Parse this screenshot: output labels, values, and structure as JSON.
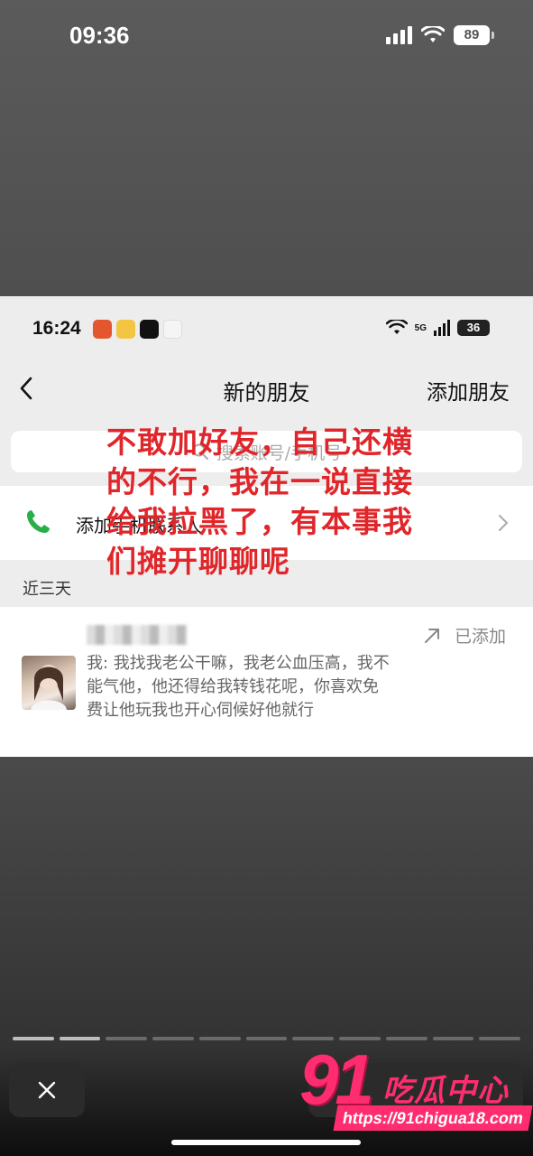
{
  "outer_status": {
    "time": "09:36",
    "battery": "89"
  },
  "inner_status": {
    "time": "16:24",
    "battery": "36",
    "network": "5G"
  },
  "nav": {
    "title": "新的朋友",
    "action": "添加朋友"
  },
  "search": {
    "placeholder": "搜索账号/手机号"
  },
  "contacts_row": {
    "label": "添加手机联系人"
  },
  "section": {
    "label": "近三天"
  },
  "friend": {
    "name": "",
    "message": "我: 我找我老公干嘛，我老公血压高，我不能气他，他还得给我转钱花呢，你喜欢免费让他玩我也开心伺候好他就行",
    "status": "已添加"
  },
  "overlay": {
    "text": "不敢加好友，自己还横的不行，我在一说直接给我拉黑了，有本事我们摊开聊聊呢"
  },
  "story": {
    "segments_total": 11,
    "segments_viewed": 2
  },
  "watermark": {
    "number": "91",
    "name": "吃瓜中心",
    "url": "https://91chigua18.com"
  },
  "colors": {
    "overlay_red": "#e0262a",
    "watermark_pink": "#ff2d6f",
    "phone_green": "#2aae4a"
  }
}
